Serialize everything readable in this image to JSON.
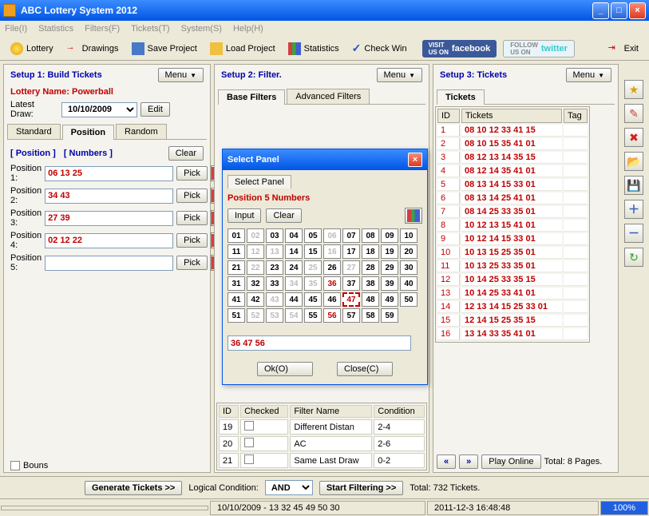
{
  "window": {
    "title": "ABC Lottery System 2012"
  },
  "menu": {
    "file": "File(I)",
    "stats": "Statistics",
    "filters": "Filters(F)",
    "tickets": "Tickets(T)",
    "system": "System(S)",
    "help": "Help(H)"
  },
  "toolbar": {
    "lottery": "Lottery",
    "drawings": "Drawings",
    "save": "Save Project",
    "load": "Load Project",
    "stats": "Statistics",
    "checkwin": "Check Win",
    "fb": "facebook",
    "tw": "twitter",
    "exit": "Exit"
  },
  "p1": {
    "title": "Setup 1: Build  Tickets",
    "menu": "Menu",
    "lottery_name": "Lottery  Name: Powerball",
    "latest_draw_label": "Latest Draw:",
    "latest_draw": "10/10/2009",
    "edit": "Edit",
    "tabs": {
      "standard": "Standard",
      "position": "Position",
      "random": "Random"
    },
    "pos_hdr1": "[ Position ]",
    "pos_hdr2": "[ Numbers ]",
    "clear": "Clear",
    "pick": "Pick",
    "positions": [
      {
        "label": "Position 1:",
        "val": "06 13 25"
      },
      {
        "label": "Position 2:",
        "val": "34 43"
      },
      {
        "label": "Position 3:",
        "val": "27 39"
      },
      {
        "label": "Position 4:",
        "val": "02 12 22"
      },
      {
        "label": "Position 5:",
        "val": ""
      }
    ],
    "bouns": "Bouns"
  },
  "p2": {
    "title": "Setup 2: Filter.",
    "menu": "Menu",
    "tabs": {
      "base": "Base Filters",
      "adv": "Advanced Filters"
    },
    "cols": {
      "id": "ID",
      "checked": "Checked",
      "name": "Filter Name",
      "cond": "Condition"
    },
    "rows": [
      {
        "id": "19",
        "name": "Different Distan",
        "cond": "2-4"
      },
      {
        "id": "20",
        "name": "AC",
        "cond": "2-6"
      },
      {
        "id": "21",
        "name": "Same Last Draw",
        "cond": "0-2"
      }
    ]
  },
  "p3": {
    "title": "Setup 3: Tickets",
    "menu": "Menu",
    "tab": "Tickets",
    "cols": {
      "id": "ID",
      "tickets": "Tickets",
      "tag": "Tag"
    },
    "rows": [
      {
        "id": "1",
        "t": "08 10 12 33 41 15"
      },
      {
        "id": "2",
        "t": "08 10 15 35 41 01"
      },
      {
        "id": "3",
        "t": "08 12 13 14 35 15"
      },
      {
        "id": "4",
        "t": "08 12 14 35 41 01"
      },
      {
        "id": "5",
        "t": "08 13 14 15 33 01"
      },
      {
        "id": "6",
        "t": "08 13 14 25 41 01"
      },
      {
        "id": "7",
        "t": "08 14 25 33 35 01"
      },
      {
        "id": "8",
        "t": "10 12 13 15 41 01"
      },
      {
        "id": "9",
        "t": "10 12 14 15 33 01"
      },
      {
        "id": "10",
        "t": "10 13 15 25 35 01"
      },
      {
        "id": "11",
        "t": "10 13 25 33 35 01"
      },
      {
        "id": "12",
        "t": "10 14 25 33 35 15"
      },
      {
        "id": "13",
        "t": "10 14 25 33 41 01"
      },
      {
        "id": "14",
        "t": "12 13 14 15 25 33 01"
      },
      {
        "id": "15",
        "t": "12 14 15 25 35 15"
      },
      {
        "id": "16",
        "t": "13 14 33 35 41 01"
      }
    ],
    "prev": "«",
    "next": "»",
    "play": "Play Online",
    "total": "Total: 8 Pages."
  },
  "dialog": {
    "title": "Select Panel",
    "tab": "Select Panel",
    "heading": "Position 5 Numbers",
    "input": "Input",
    "clear": "Clear",
    "selected": "36 47 56",
    "ok": "Ok(O)",
    "close": "Close(C)",
    "disabled": [
      2,
      6,
      12,
      13,
      16,
      22,
      25,
      27,
      34,
      35,
      43,
      52,
      53,
      54
    ],
    "sel": [
      36,
      47,
      56
    ],
    "hl": 47
  },
  "bottom": {
    "gen": "Generate Tickets >>",
    "logical": "Logical Condition:",
    "and": "AND",
    "startfilter": "Start Filtering >>",
    "total": "Total: 732 Tickets."
  },
  "status": {
    "draw": "10/10/2009 - 13 32 45 49 50 30",
    "date": "2011-12-3 16:48:48",
    "prog": "100%"
  }
}
